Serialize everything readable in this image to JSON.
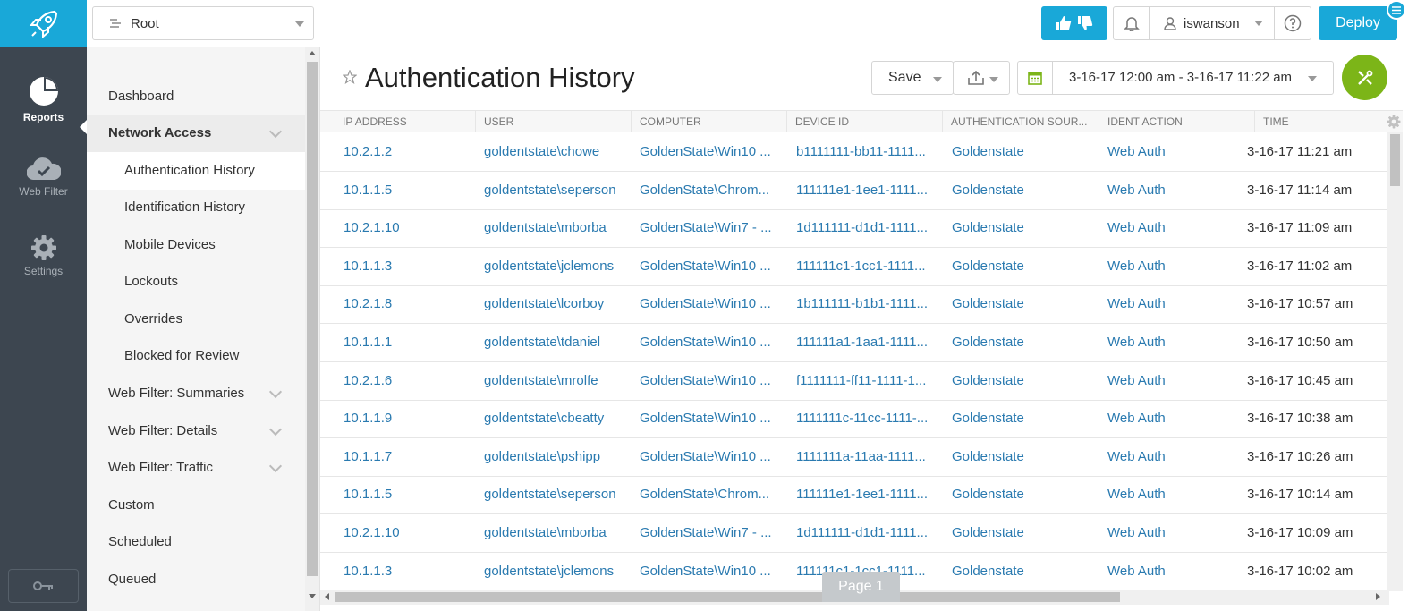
{
  "rail": {
    "items": [
      {
        "label": "Reports",
        "icon": "pie-chart-icon"
      },
      {
        "label": "Web Filter",
        "icon": "cloud-check-icon"
      },
      {
        "label": "Settings",
        "icon": "gear-icon"
      }
    ]
  },
  "topbar": {
    "scope": "Root",
    "user": "iswanson",
    "deploy": "Deploy"
  },
  "nav": {
    "items": [
      {
        "label": "Dashboard"
      },
      {
        "label": "Network Access"
      },
      {
        "label": "Authentication History"
      },
      {
        "label": "Identification History"
      },
      {
        "label": "Mobile Devices"
      },
      {
        "label": "Lockouts"
      },
      {
        "label": "Overrides"
      },
      {
        "label": "Blocked for Review"
      },
      {
        "label": "Web Filter: Summaries"
      },
      {
        "label": "Web Filter: Details"
      },
      {
        "label": "Web Filter: Traffic"
      },
      {
        "label": "Custom"
      },
      {
        "label": "Scheduled"
      },
      {
        "label": "Queued"
      }
    ]
  },
  "main": {
    "title": "Authentication History",
    "save": "Save",
    "date_range": "3-16-17 12:00 am - 3-16-17 11:22 am",
    "page_label": "Page 1"
  },
  "table": {
    "columns": [
      "IP ADDRESS",
      "USER",
      "COMPUTER",
      "DEVICE ID",
      "AUTHENTICATION SOUR...",
      "IDENT ACTION",
      "TIME"
    ],
    "rows": [
      [
        "10.2.1.2",
        "goldentstate\\chowe",
        "GoldenState\\Win10 ...",
        "b1111111-bb11-1111...",
        "Goldenstate",
        "Web Auth",
        "3-16-17 11:21 am"
      ],
      [
        "10.1.1.5",
        "goldentstate\\seperson",
        "GoldenState\\Chrom...",
        "111111e1-1ee1-1111...",
        "Goldenstate",
        "Web Auth",
        "3-16-17 11:14 am"
      ],
      [
        "10.2.1.10",
        "goldentstate\\mborba",
        "GoldenState\\Win7 - ...",
        "1d111111-d1d1-1111...",
        "Goldenstate",
        "Web Auth",
        "3-16-17 11:09 am"
      ],
      [
        "10.1.1.3",
        "goldentstate\\jclemons",
        "GoldenState\\Win10 ...",
        "111111c1-1cc1-1111...",
        "Goldenstate",
        "Web Auth",
        "3-16-17 11:02 am"
      ],
      [
        "10.2.1.8",
        "goldentstate\\lcorboy",
        "GoldenState\\Win10 ...",
        "1b111111-b1b1-1111...",
        "Goldenstate",
        "Web Auth",
        "3-16-17 10:57 am"
      ],
      [
        "10.1.1.1",
        "goldentstate\\tdaniel",
        "GoldenState\\Win10 ...",
        "111111a1-1aa1-1111...",
        "Goldenstate",
        "Web Auth",
        "3-16-17 10:50 am"
      ],
      [
        "10.2.1.6",
        "goldentstate\\mrolfe",
        "GoldenState\\Win10 ...",
        "f1111111-ff11-1111-1...",
        "Goldenstate",
        "Web Auth",
        "3-16-17 10:45 am"
      ],
      [
        "10.1.1.9",
        "goldentstate\\cbeatty",
        "GoldenState\\Win10 ...",
        "1111111c-11cc-1111-...",
        "Goldenstate",
        "Web Auth",
        "3-16-17 10:38 am"
      ],
      [
        "10.1.1.7",
        "goldentstate\\pshipp",
        "GoldenState\\Win10 ...",
        "1111111a-11aa-1111...",
        "Goldenstate",
        "Web Auth",
        "3-16-17 10:26 am"
      ],
      [
        "10.1.1.5",
        "goldentstate\\seperson",
        "GoldenState\\Chrom...",
        "111111e1-1ee1-1111...",
        "Goldenstate",
        "Web Auth",
        "3-16-17 10:14 am"
      ],
      [
        "10.2.1.10",
        "goldentstate\\mborba",
        "GoldenState\\Win7 - ...",
        "1d111111-d1d1-1111...",
        "Goldenstate",
        "Web Auth",
        "3-16-17 10:09 am"
      ],
      [
        "10.1.1.3",
        "goldentstate\\jclemons",
        "GoldenState\\Win10 ...",
        "111111c1-1cc1-1111...",
        "Goldenstate",
        "Web Auth",
        "3-16-17 10:02 am"
      ]
    ]
  },
  "colors": {
    "brand": "#19a8d8",
    "rail": "#3d4650",
    "link": "#2a7ab0",
    "tools": "#7cb518"
  }
}
